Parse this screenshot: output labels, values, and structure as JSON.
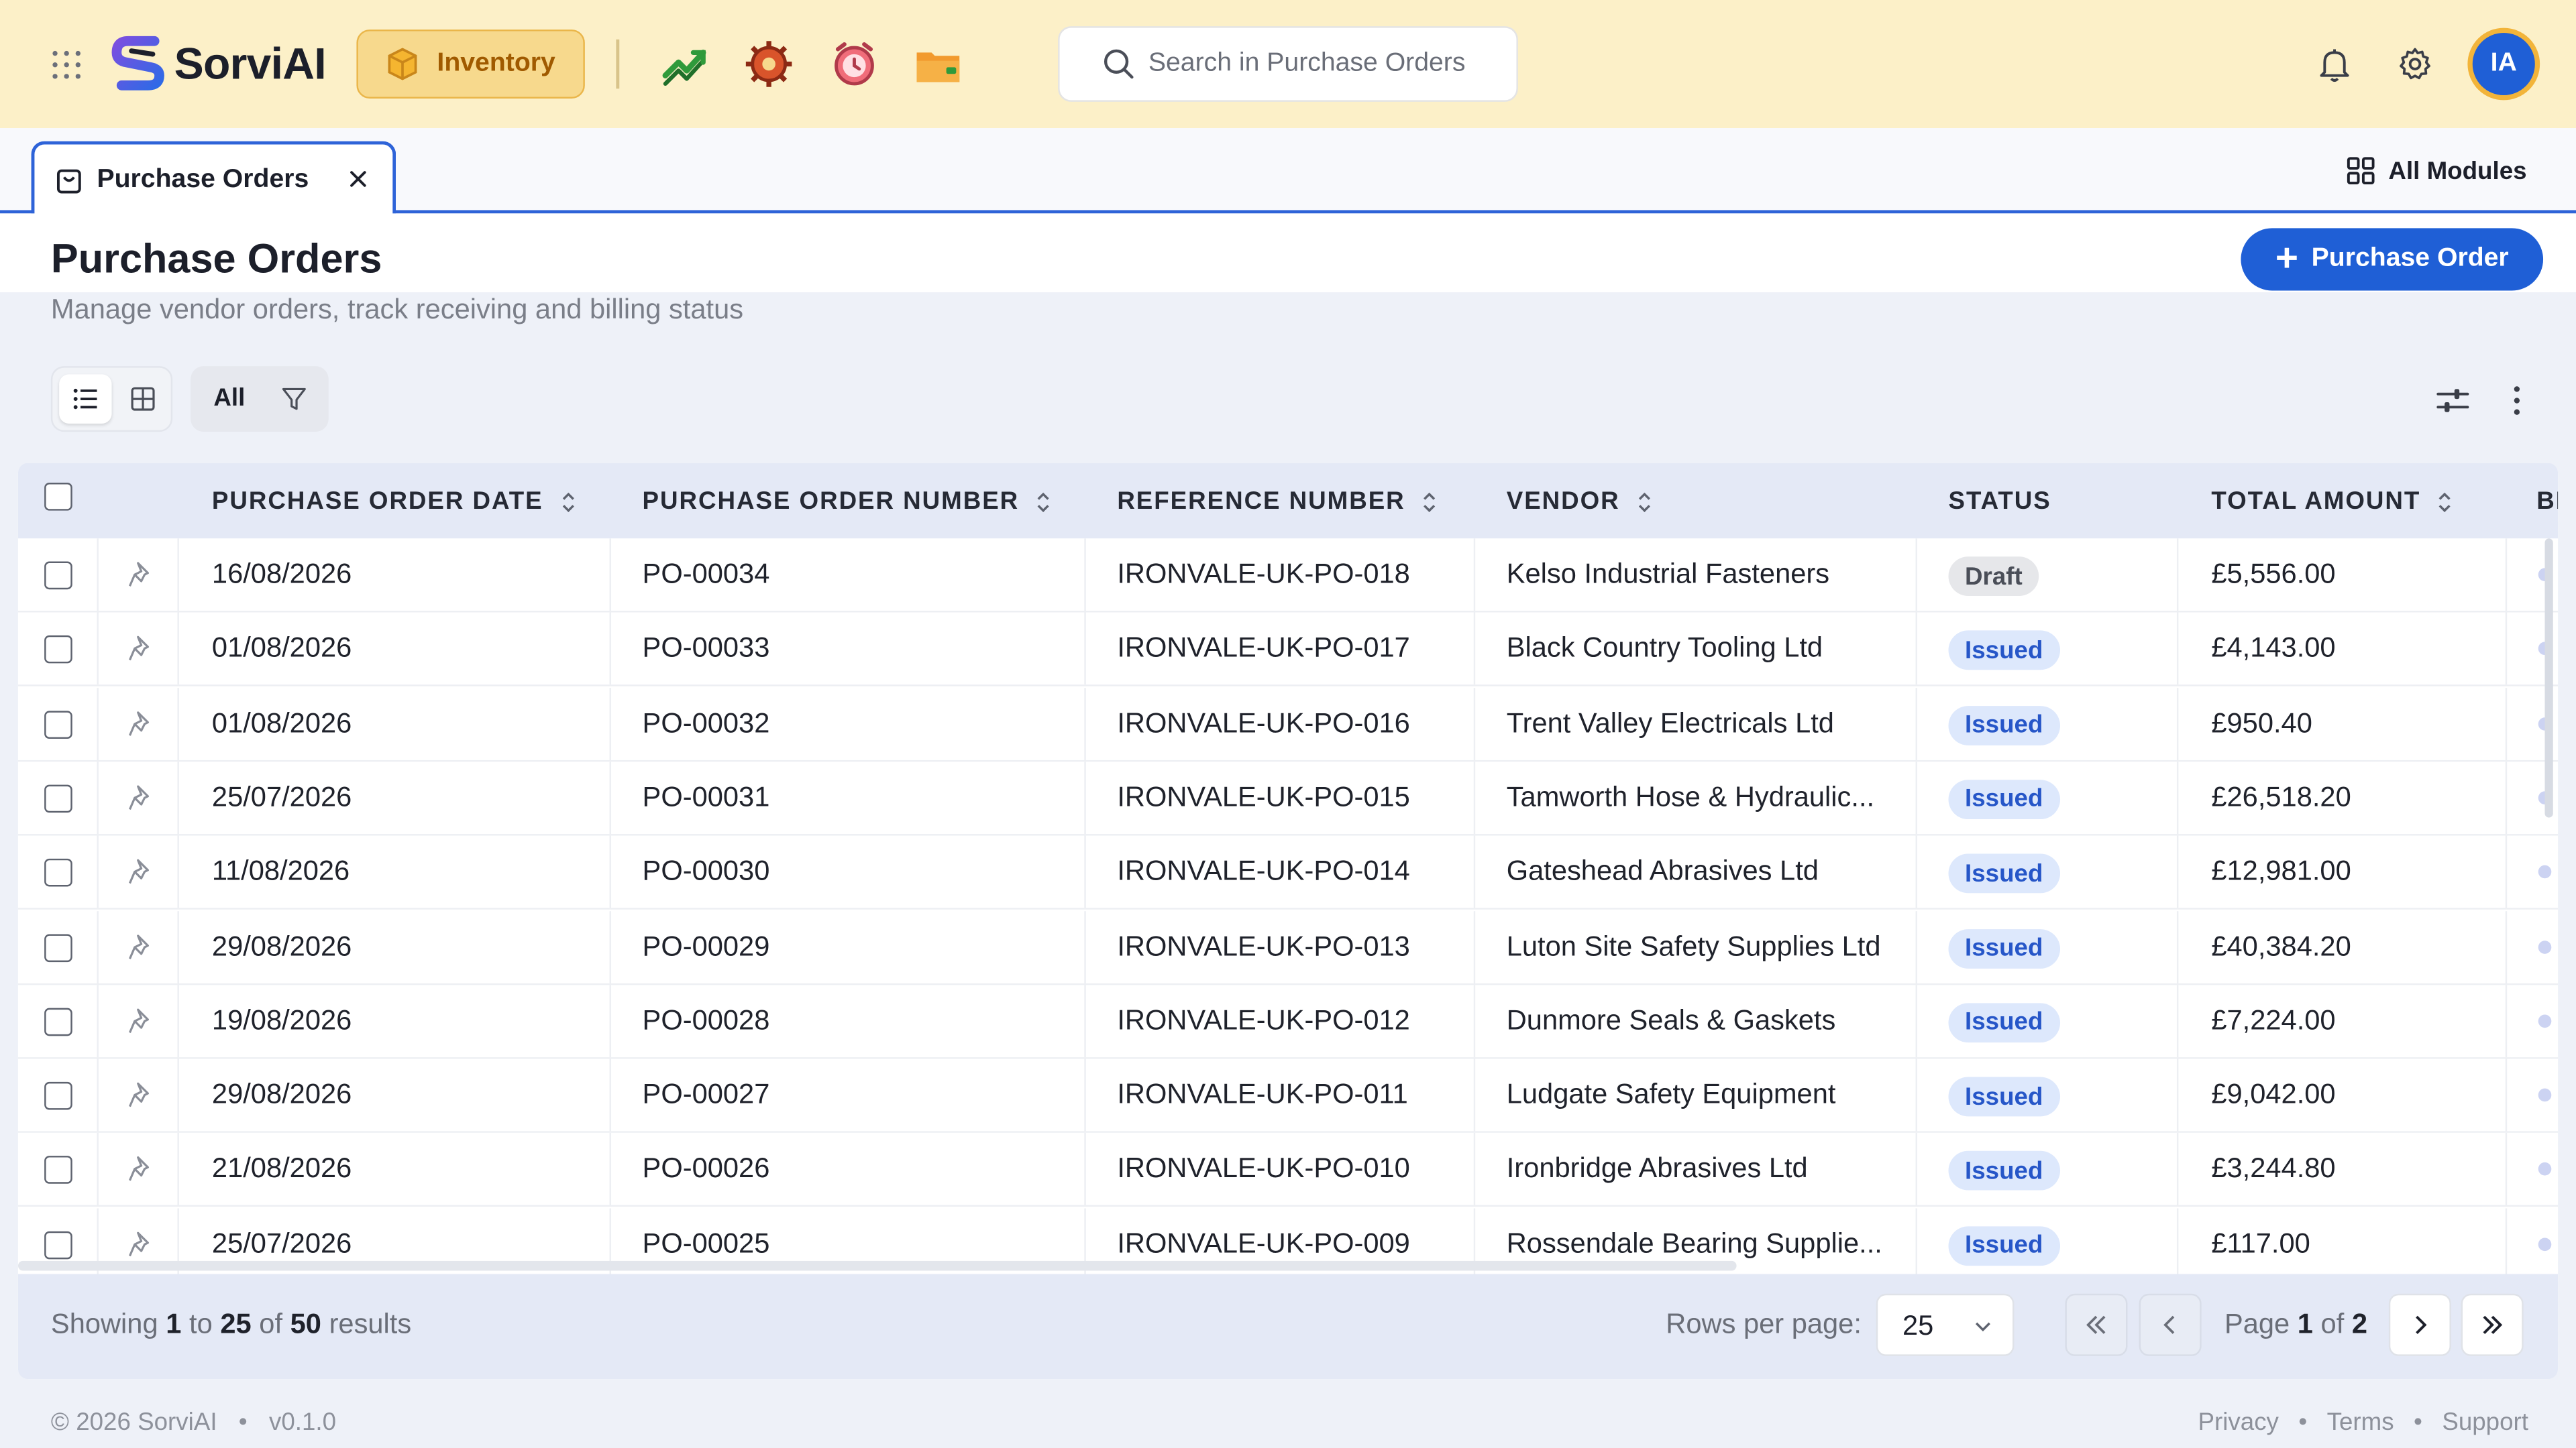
{
  "app": {
    "name": "SorviAI",
    "active_module": "Inventory",
    "search_placeholder": "Search in Purchase Orders",
    "user_initials": "IA"
  },
  "tabs": {
    "open_tab": "Purchase Orders",
    "all_modules": "All Modules"
  },
  "page": {
    "title": "Purchase Orders",
    "subtitle": "Manage vendor orders, track receiving and billing status",
    "new_button": "Purchase Order"
  },
  "toolbar": {
    "filter_label": "All"
  },
  "table": {
    "columns": [
      "PURCHASE ORDER DATE",
      "PURCHASE ORDER NUMBER",
      "REFERENCE NUMBER",
      "VENDOR",
      "STATUS",
      "TOTAL AMOUNT",
      "BI"
    ],
    "rows": [
      {
        "date": "16/08/2026",
        "number": "PO-00034",
        "reference": "IRONVALE-UK-PO-018",
        "vendor": "Kelso Industrial Fasteners",
        "status": "Draft",
        "total": "£5,556.00"
      },
      {
        "date": "01/08/2026",
        "number": "PO-00033",
        "reference": "IRONVALE-UK-PO-017",
        "vendor": "Black Country Tooling Ltd",
        "status": "Issued",
        "total": "£4,143.00"
      },
      {
        "date": "01/08/2026",
        "number": "PO-00032",
        "reference": "IRONVALE-UK-PO-016",
        "vendor": "Trent Valley Electricals Ltd",
        "status": "Issued",
        "total": "£950.40"
      },
      {
        "date": "25/07/2026",
        "number": "PO-00031",
        "reference": "IRONVALE-UK-PO-015",
        "vendor": "Tamworth Hose & Hydraulic...",
        "status": "Issued",
        "total": "£26,518.20"
      },
      {
        "date": "11/08/2026",
        "number": "PO-00030",
        "reference": "IRONVALE-UK-PO-014",
        "vendor": "Gateshead Abrasives Ltd",
        "status": "Issued",
        "total": "£12,981.00"
      },
      {
        "date": "29/08/2026",
        "number": "PO-00029",
        "reference": "IRONVALE-UK-PO-013",
        "vendor": "Luton Site Safety Supplies Ltd",
        "status": "Issued",
        "total": "£40,384.20"
      },
      {
        "date": "19/08/2026",
        "number": "PO-00028",
        "reference": "IRONVALE-UK-PO-012",
        "vendor": "Dunmore Seals & Gaskets",
        "status": "Issued",
        "total": "£7,224.00"
      },
      {
        "date": "29/08/2026",
        "number": "PO-00027",
        "reference": "IRONVALE-UK-PO-011",
        "vendor": "Ludgate Safety Equipment",
        "status": "Issued",
        "total": "£9,042.00"
      },
      {
        "date": "21/08/2026",
        "number": "PO-00026",
        "reference": "IRONVALE-UK-PO-010",
        "vendor": "Ironbridge Abrasives Ltd",
        "status": "Issued",
        "total": "£3,244.80"
      },
      {
        "date": "25/07/2026",
        "number": "PO-00025",
        "reference": "IRONVALE-UK-PO-009",
        "vendor": "Rossendale Bearing Supplie...",
        "status": "Issued",
        "total": "£117.00"
      }
    ]
  },
  "pagination": {
    "showing_prefix": "Showing",
    "from": "1",
    "to_word": "to",
    "to": "25",
    "of_word": "of",
    "total": "50",
    "results_word": "results",
    "rows_per_page_label": "Rows per page:",
    "rows_per_page": "25",
    "page_word": "Page",
    "current_page": "1",
    "page_of_word": "of",
    "page_count": "2"
  },
  "footer": {
    "copyright": "© 2026 SorviAI",
    "version": "v0.1.0",
    "links": [
      "Privacy",
      "Terms",
      "Support"
    ],
    "separator": "•"
  },
  "colors": {
    "topbar_bg": "#fcf0c8",
    "accent": "#1f5fd6",
    "draft_badge": "#e6e7ea",
    "issued_badge": "#dde8fc"
  },
  "icons": {
    "apps_grid": "grid-dots-icon",
    "module": "inventory-box-icon",
    "apps": [
      "trending-chart-icon",
      "gear-wrench-icon",
      "alarm-clock-icon",
      "folder-icon"
    ],
    "search": "search-icon",
    "notifications": "bell-icon",
    "settings": "gear-icon"
  }
}
